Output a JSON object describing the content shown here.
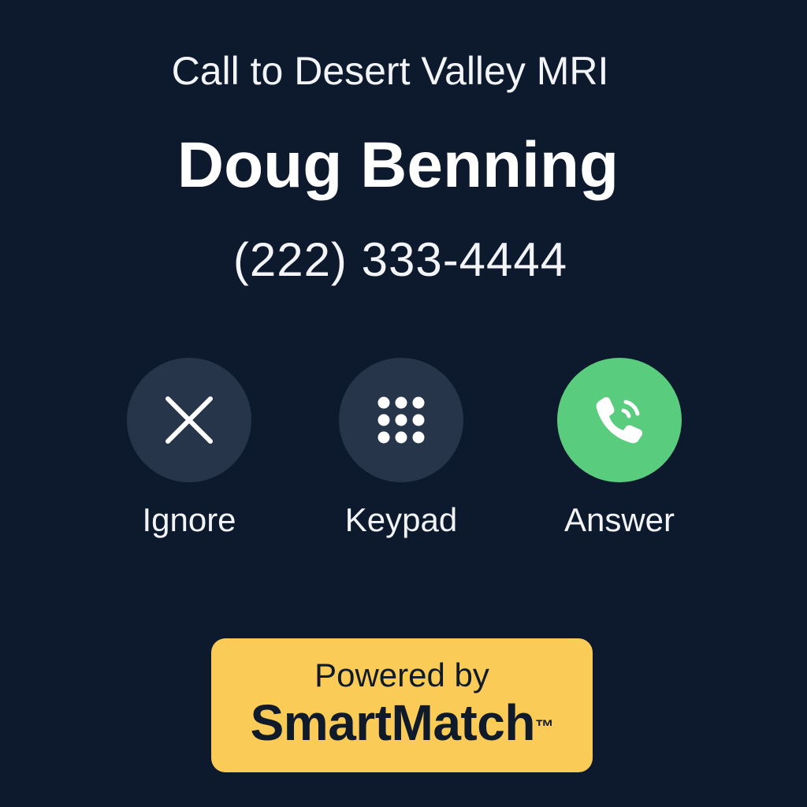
{
  "call": {
    "context": "Call to Desert Valley MRI",
    "caller_name": "Doug Benning",
    "caller_number": "(222) 333-4444"
  },
  "actions": [
    {
      "label": "Ignore",
      "icon": "close-icon",
      "color": "#26354a"
    },
    {
      "label": "Keypad",
      "icon": "keypad-icon",
      "color": "#26354a"
    },
    {
      "label": "Answer",
      "icon": "phone-ringing-icon",
      "color": "#5acc7e"
    }
  ],
  "badge": {
    "prefix": "Powered by",
    "brand": "SmartMatch",
    "trademark": "™",
    "color": "#fbcb58"
  },
  "colors": {
    "background": "#0d1a2e",
    "button": "#26354a",
    "answer": "#5acc7e",
    "badge": "#fbcb58"
  }
}
